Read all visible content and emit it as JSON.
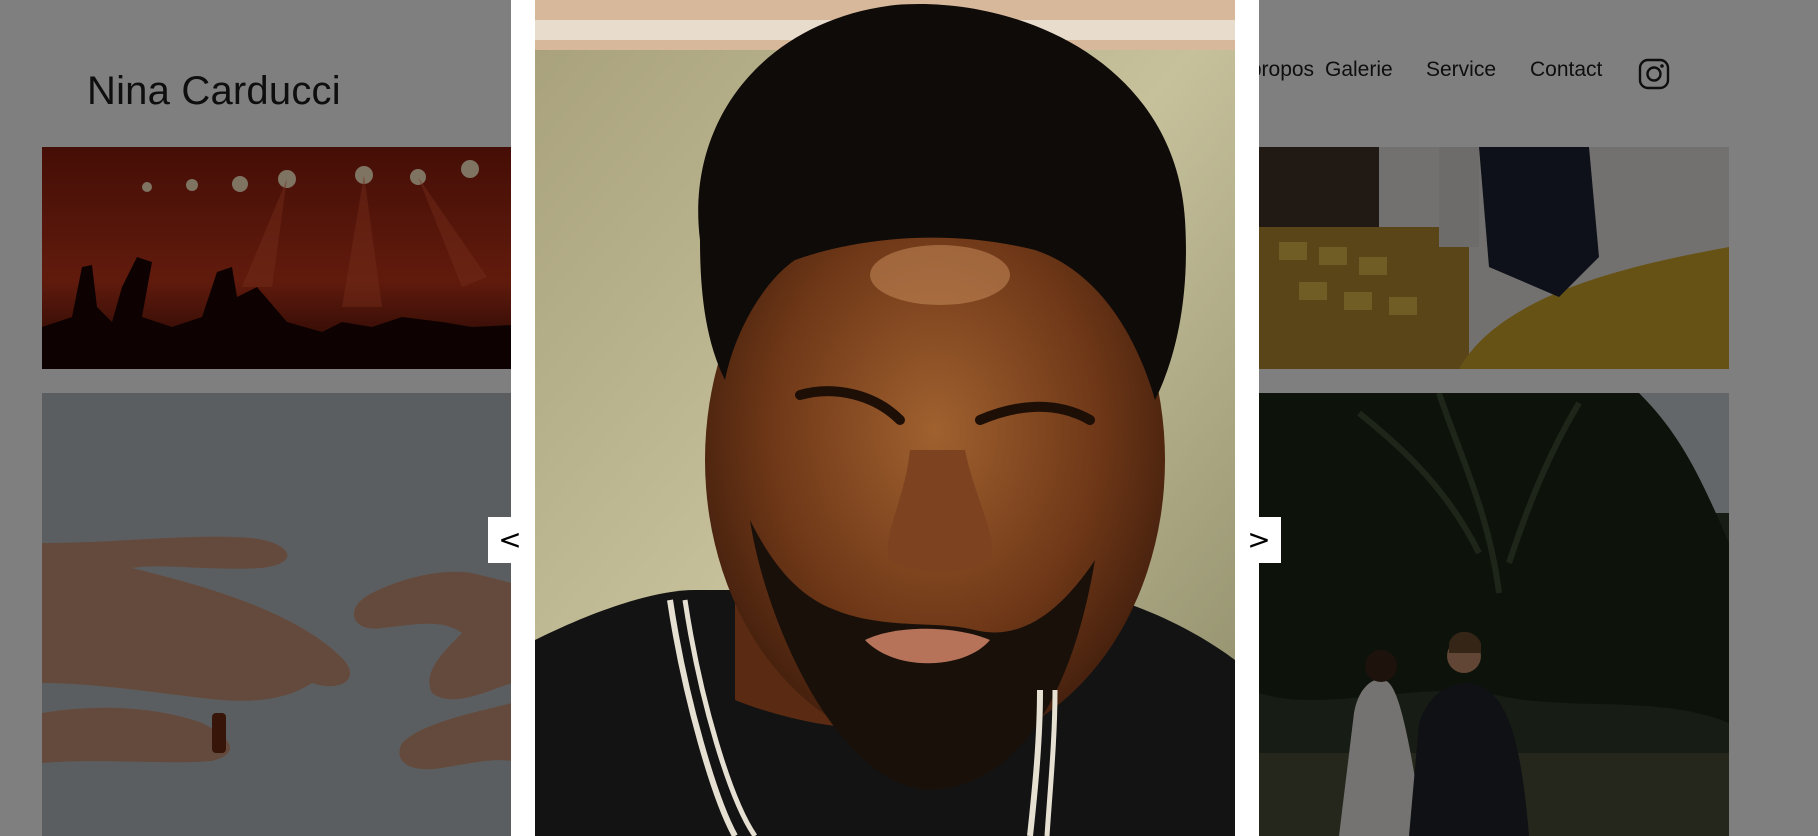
{
  "header": {
    "site_title": "Nina Carducci",
    "nav": [
      {
        "label": "À propos"
      },
      {
        "label": "Galerie"
      },
      {
        "label": "Service"
      },
      {
        "label": "Contact"
      }
    ],
    "social_icon": "instagram-icon"
  },
  "gallery": {
    "items": [
      {
        "subject": "concert"
      },
      {
        "subject": "office"
      },
      {
        "subject": "hands"
      },
      {
        "subject": "wedding"
      }
    ]
  },
  "lightbox": {
    "open": true,
    "prev_label": "<",
    "next_label": ">",
    "image_subject": "portrait"
  },
  "colors": {
    "overlay": "#000000",
    "modal_bg": "#ffffff",
    "text": "#1c1c1c"
  }
}
